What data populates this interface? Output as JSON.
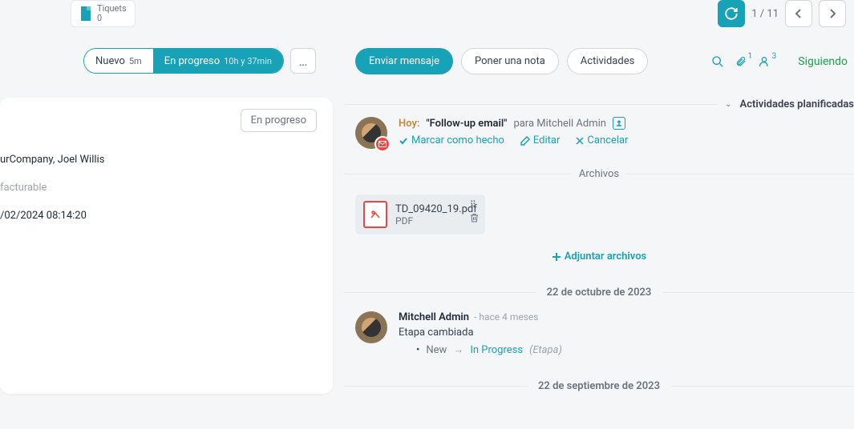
{
  "topbar": {
    "tiquets_label": "Tiquets",
    "tiquets_count": "0",
    "pager": "1 / 11"
  },
  "status": {
    "nuevo": "Nuevo",
    "nuevo_dur": "5m",
    "progreso": "En progreso",
    "progreso_dur": "10h y 37min"
  },
  "left": {
    "chip": "En progreso",
    "row1": "urCompany, Joel Willis",
    "row2": "facturable",
    "row3": "/02/2024 08:14:20"
  },
  "right": {
    "enviar": "Enviar mensaje",
    "nota": "Poner una nota",
    "actividades": "Actividades",
    "attach_badge": "1",
    "follow_badge": "3",
    "siguiendo": "Siguiendo"
  },
  "planned": {
    "title": "Actividades planificadas",
    "hoy": "Hoy:",
    "quote": "\"Follow-up email\"",
    "para": "para Mitchell Admin",
    "done": "Marcar como hecho",
    "edit": "Editar",
    "cancel": "Cancelar"
  },
  "archivos": {
    "title": "Archivos",
    "file_name": "TD_09420_19.pdf",
    "file_type": "PDF",
    "attach": "Adjuntar archivos"
  },
  "dates": {
    "d1": "22 de octubre de 2023",
    "d2": "22 de septiembre de 2023"
  },
  "log": {
    "author": "Mitchell Admin",
    "time": "- hace 4 meses",
    "text": "Etapa cambiada",
    "from": "New",
    "to": "In Progress",
    "label": "(Etapa)"
  }
}
